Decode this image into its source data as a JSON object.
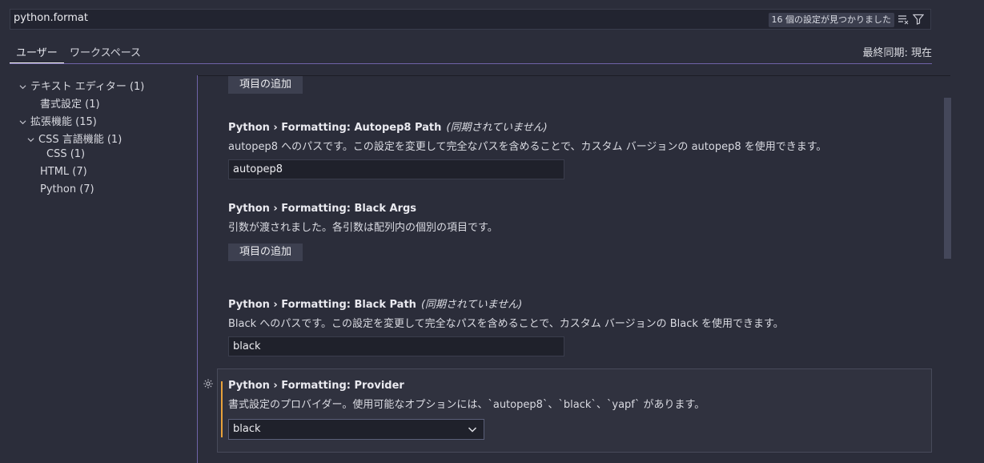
{
  "search": {
    "value": "python.format",
    "result_count": "16 個の設定が見つかりました"
  },
  "tabs": {
    "user": "ユーザー",
    "workspace": "ワークスペース"
  },
  "sync_status": "最終同期: 現在",
  "toc": [
    {
      "label": "テキスト エディター (1)",
      "expanded": true
    },
    {
      "label": "書式設定 (1)"
    },
    {
      "label": "拡張機能 (15)",
      "expanded": true
    },
    {
      "label": "CSS 言語機能 (1)",
      "expanded": true
    },
    {
      "label": "CSS (1)"
    },
    {
      "label": "HTML (7)"
    },
    {
      "label": "Python (7)"
    }
  ],
  "settings": {
    "top_add_button": "項目の追加",
    "autopep8_path": {
      "title": "Python › Formatting: Autopep8 Path",
      "nosync": "(同期されていません)",
      "description": "autopep8 へのパスです。この設定を変更して完全なパスを含めることで、カスタム バージョンの autopep8 を使用できます。",
      "value": "autopep8"
    },
    "black_args": {
      "title": "Python › Formatting: Black Args",
      "description": "引数が渡されました。各引数は配列内の個別の項目です。",
      "button": "項目の追加"
    },
    "black_path": {
      "title": "Python › Formatting: Black Path",
      "nosync": "(同期されていません)",
      "description": "Black へのパスです。この設定を変更して完全なパスを含めることで、カスタム バージョンの Black を使用できます。",
      "value": "black"
    },
    "provider": {
      "title": "Python › Formatting: Provider",
      "description": "書式設定のプロバイダー。使用可能なオプションには、`autopep8`、`black`、`yapf` があります。",
      "value": "black"
    }
  },
  "colors": {
    "accent": "#6f63a8",
    "modified": "#e8a13a",
    "background": "#2b2d3a"
  },
  "icons": {
    "clear": "clear-filter-icon",
    "filter": "filter-icon",
    "gear": "gear-icon",
    "chevron": "chevron-down-icon"
  }
}
